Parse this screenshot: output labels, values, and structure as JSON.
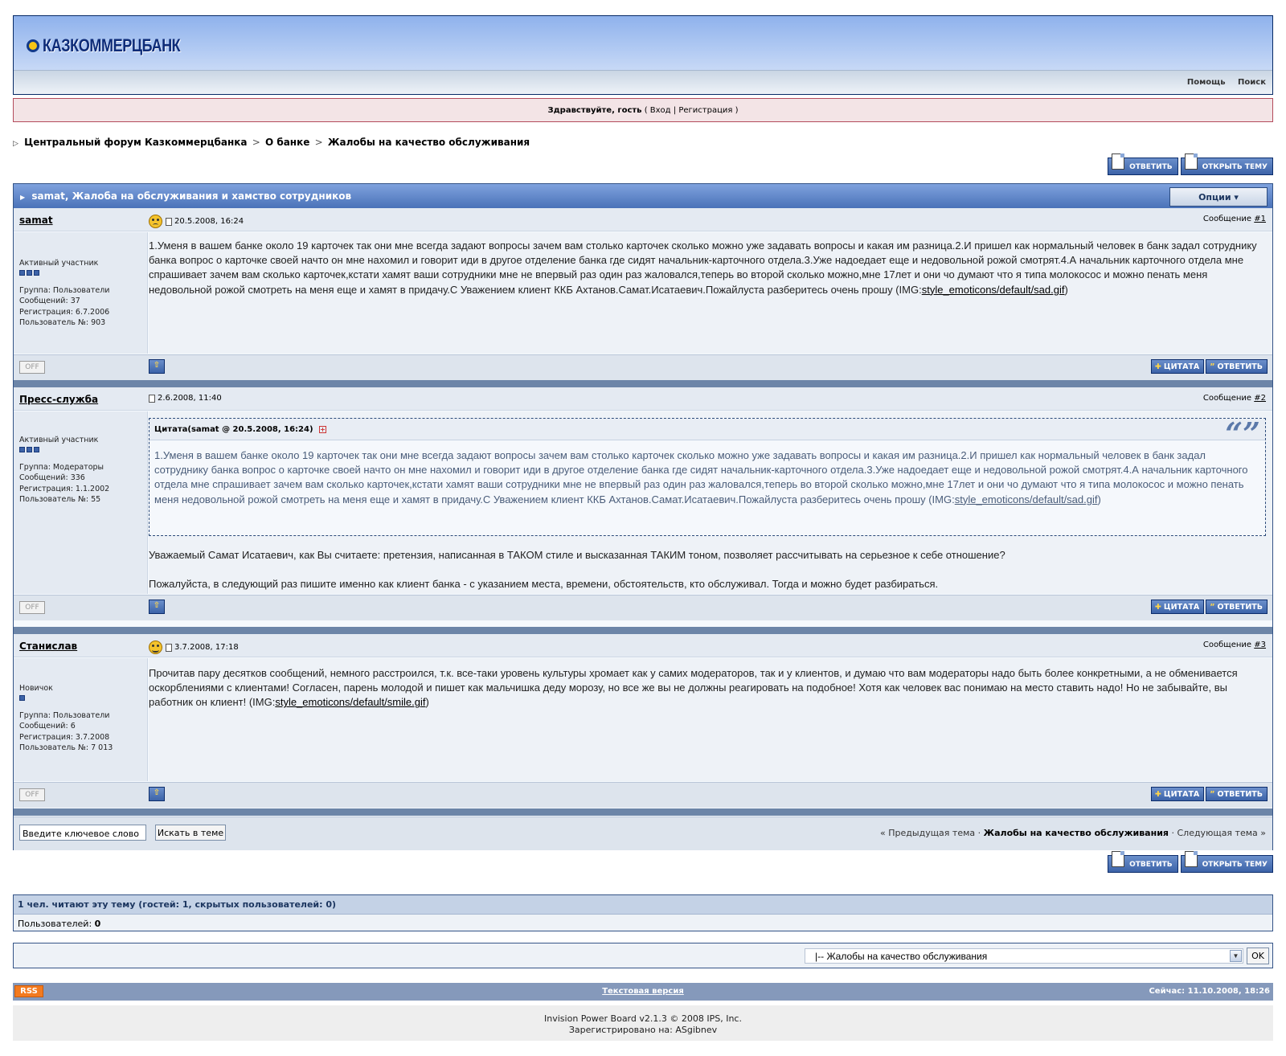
{
  "header": {
    "logo_text": "КАЗКОММЕРЦБАНК",
    "links": [
      "Помощь",
      "Поиск"
    ]
  },
  "guest": {
    "greeting": "Здравствуйте, гость",
    "open": "(",
    "login": "Вход",
    "sep": "|",
    "register": "Регистрация",
    "close": ")"
  },
  "breadcrumb": {
    "items": [
      "Центральный форум Казкоммерцбанка",
      "О банке",
      "Жалобы на качество обслуживания"
    ],
    "sep": ">"
  },
  "buttons": {
    "reply": "ОТВЕТИТЬ",
    "new_topic": "ОТКРЫТЬ ТЕМУ",
    "quote": "ЦИТАТА",
    "reply_small": "ОТВЕТИТЬ",
    "off": "OFF"
  },
  "topic": {
    "title": "samat, Жалоба на обслуживания и хамство сотрудников",
    "options": "Опции ▾"
  },
  "posts": [
    {
      "author": "samat",
      "date": "20.5.2008, 16:24",
      "number_label": "Сообщение",
      "number": "#1",
      "rank": "Активный участник",
      "group": "Группа: Пользователи",
      "messages": "Сообщений: 37",
      "registered": "Регистрация: 6.7.2006",
      "user_no": "Пользователь №: 903",
      "text": "1.Уменя в вашем банке около 19 карточек так они мне всегда задают вопросы зачем вам столько карточек сколько можно уже задавать вопросы и какая им разница.2.И пришел как нормальный человек в банк задал сотруднику банка вопрос о карточке своей начто он мне нахомил и говорит иди в другое отделение банка где сидят начальник-карточного отдела.3.Уже надоедает еще и недовольной рожой смотрят.4.А начальник карточного отдела мне спрашивает зачем вам сколько карточек,кстати хамят ваши сотрудники мне не впервый раз один раз жаловался,теперь во второй сколько можно,мне 17лет и они чо думают что я типа молокосос и можно пенать меня недовольной рожой смотреть на меня еще и хамят в придачу.С Уважением клиент ККБ Ахтанов.Самат.Исатаевич.Пожайлуста разберитесь очень прошу (IMG:",
      "link": "style_emoticons/default/sad.gif",
      "text_end": ")"
    },
    {
      "author": "Пресс-служба",
      "date": "2.6.2008, 11:40",
      "number_label": "Сообщение",
      "number": "#2",
      "rank": "Активный участник",
      "group": "Группа: Модераторы",
      "messages": "Сообщений: 336",
      "registered": "Регистрация: 1.1.2002",
      "user_no": "Пользователь №: 55",
      "quote_header": "Цитата(samat @ 20.5.2008, 16:24)",
      "quote_text": "1.Уменя в вашем банке около 19 карточек так они мне всегда задают вопросы зачем вам столько карточек сколько можно уже задавать вопросы и какая им разница.2.И пришел как нормальный человек в банк задал сотруднику банка вопрос о карточке своей начто он мне нахомил и говорит иди в другое отделение банка где сидят начальник-карточного отдела.3.Уже надоедает еще и недовольной рожой смотрят.4.А начальник карточного отдела мне спрашивает зачем вам сколько карточек,кстати хамят ваши сотрудники мне не впервый раз один раз жаловался,теперь во второй сколько можно,мне 17лет и они чо думают что я типа молокосос и можно пенать меня недовольной рожой смотреть на меня еще и хамят в придачу.С Уважением клиент ККБ Ахтанов.Самат.Исатаевич.Пожайлуста разберитесь очень прошу (IMG:",
      "quote_link": "style_emoticons/default/sad.gif",
      "quote_end": ")",
      "para1": "Уважаемый Самат Исатаевич, как Вы считаете: претензия, написанная в ТАКОМ стиле и высказанная ТАКИМ тоном, позволяет рассчитывать на серьезное к себе отношение?",
      "para2": "Пожалуйста, в следующий раз пишите именно как клиент банка - с указанием места, времени, обстоятельств, кто обслуживал. Тогда и можно будет разбираться."
    },
    {
      "author": "Станислав",
      "date": "3.7.2008, 17:18",
      "number_label": "Сообщение",
      "number": "#3",
      "rank": "Новичок",
      "group": "Группа: Пользователи",
      "messages": "Сообщений: 6",
      "registered": "Регистрация: 3.7.2008",
      "user_no": "Пользователь №: 7 013",
      "text": "Прочитав пару десятков сообщений, немного расстроился, т.к. все-таки уровень культуры хромает как у самих модераторов, так и у клиентов, и думаю что вам модераторы надо быть более конкретными, а не обменивается оскорблениями с клиентами! Согласен, парень молодой и пишет как мальчишка деду морозу, но все же вы не должны реагировать на подобное! Хотя как человек вас понимаю на место ставить надо! Но не забывайте, вы работник он клиент! (IMG:",
      "link": "style_emoticons/default/smile.gif",
      "text_end": ")"
    }
  ],
  "search": {
    "placeholder": "Введите ключевое слово",
    "button": "Искать в теме"
  },
  "topic_nav": {
    "prev": "« Предыдущая тема ·",
    "current": "Жалобы на качество обслуживания",
    "next": "· Следующая тема »"
  },
  "readers": {
    "header": "1 чел. читают эту тему (гостей: 1, скрытых пользователей: 0)",
    "users_label": "Пользователей:",
    "users_count": "0"
  },
  "jump": {
    "selected": "|-- Жалобы на качество обслуживания",
    "ok": "OK"
  },
  "footer": {
    "rss": "RSS",
    "text_version": "Текстовая версия",
    "now": "Сейчас: 11.10.2008, 18:26",
    "copyright": "Invision Power Board v2.1.3 © 2008  IPS, Inc.",
    "registered": "Зарегистрировано на: ASgibnev"
  },
  "colors": {
    "header_blue": "#8fb2ec",
    "border": "#345487",
    "guest_bg": "#f3e4e6",
    "button_blue": "#3c63a8"
  }
}
